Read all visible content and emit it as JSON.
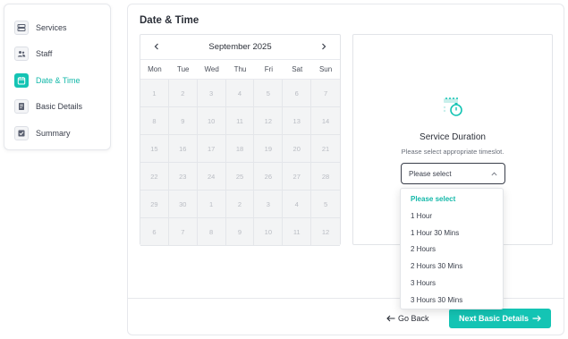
{
  "sidebar": {
    "items": [
      {
        "label": "Services",
        "icon": "server-icon",
        "active": false
      },
      {
        "label": "Staff",
        "icon": "users-icon",
        "active": false
      },
      {
        "label": "Date & Time",
        "icon": "calendar-icon",
        "active": true
      },
      {
        "label": "Basic Details",
        "icon": "document-icon",
        "active": false
      },
      {
        "label": "Summary",
        "icon": "checklist-icon",
        "active": false
      }
    ]
  },
  "main": {
    "title": "Date & Time"
  },
  "calendar": {
    "month": "September 2025",
    "weekdays": [
      "Mon",
      "Tue",
      "Wed",
      "Thu",
      "Fri",
      "Sat",
      "Sun"
    ],
    "days": [
      "1",
      "2",
      "3",
      "4",
      "5",
      "6",
      "7",
      "8",
      "9",
      "10",
      "11",
      "12",
      "13",
      "14",
      "15",
      "16",
      "17",
      "18",
      "19",
      "20",
      "21",
      "22",
      "23",
      "24",
      "25",
      "26",
      "27",
      "28",
      "29",
      "30",
      "1",
      "2",
      "3",
      "4",
      "5",
      "6",
      "7",
      "8",
      "9",
      "10",
      "11",
      "12"
    ]
  },
  "duration": {
    "title": "Service Duration",
    "subtitle": "Please select appropriate timeslot.",
    "select_value": "Please select",
    "options": [
      "Please select",
      "1 Hour",
      "1 Hour 30 Mins",
      "2 Hours",
      "2 Hours 30 Mins",
      "3 Hours",
      "3 Hours 30 Mins"
    ],
    "selected_index": 0
  },
  "footer": {
    "back_label": "Go Back",
    "next_label": "Next Basic Details"
  },
  "colors": {
    "accent": "#14c4b4",
    "disabled_day": "#f3f4f5",
    "text": "#3a3f4b"
  }
}
